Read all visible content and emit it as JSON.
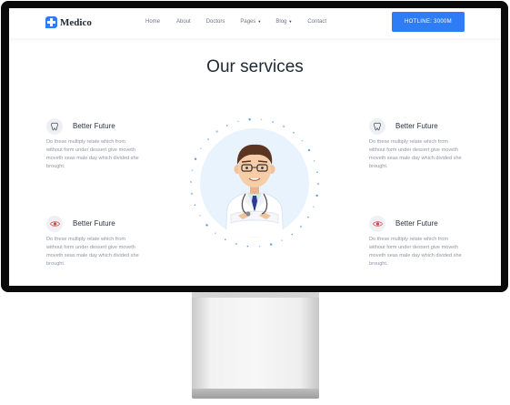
{
  "brand": {
    "name": "Medico"
  },
  "nav": {
    "items": [
      {
        "label": "Home",
        "caret": false
      },
      {
        "label": "About",
        "caret": false
      },
      {
        "label": "Doctors",
        "caret": false
      },
      {
        "label": "Pages",
        "caret": true
      },
      {
        "label": "Blog",
        "caret": true
      },
      {
        "label": "Contact",
        "caret": false
      }
    ],
    "caret_glyph": "▼",
    "cta_label": "HOTLINE: 3000M"
  },
  "section": {
    "title": "Our services"
  },
  "services": [
    {
      "title": "Better Future",
      "icon": "tooth-icon",
      "glyph": "🦷",
      "text": "Do these multiply relate which from without form under dessert give moveth moveth seas male day which divided she brought."
    },
    {
      "title": "Better Future",
      "icon": "tooth-icon",
      "glyph": "🦷",
      "text": "Do these multiply relate which from without form under dessert give moveth moveth seas male day which divided she brought."
    },
    {
      "title": "Better Future",
      "icon": "eye-icon",
      "glyph": "◉",
      "text": "Do these multiply relate which from without form under dessert give moveth moveth seas male day which divided she brought."
    },
    {
      "title": "Better Future",
      "icon": "eye-icon",
      "glyph": "◉",
      "text": "Do these multiply relate which from without form under dessert give moveth moveth seas male day which divided she brought."
    }
  ],
  "colors": {
    "accent": "#2f7df5",
    "circle_bg": "#e9f3fd",
    "dots": "#4a90e2"
  }
}
